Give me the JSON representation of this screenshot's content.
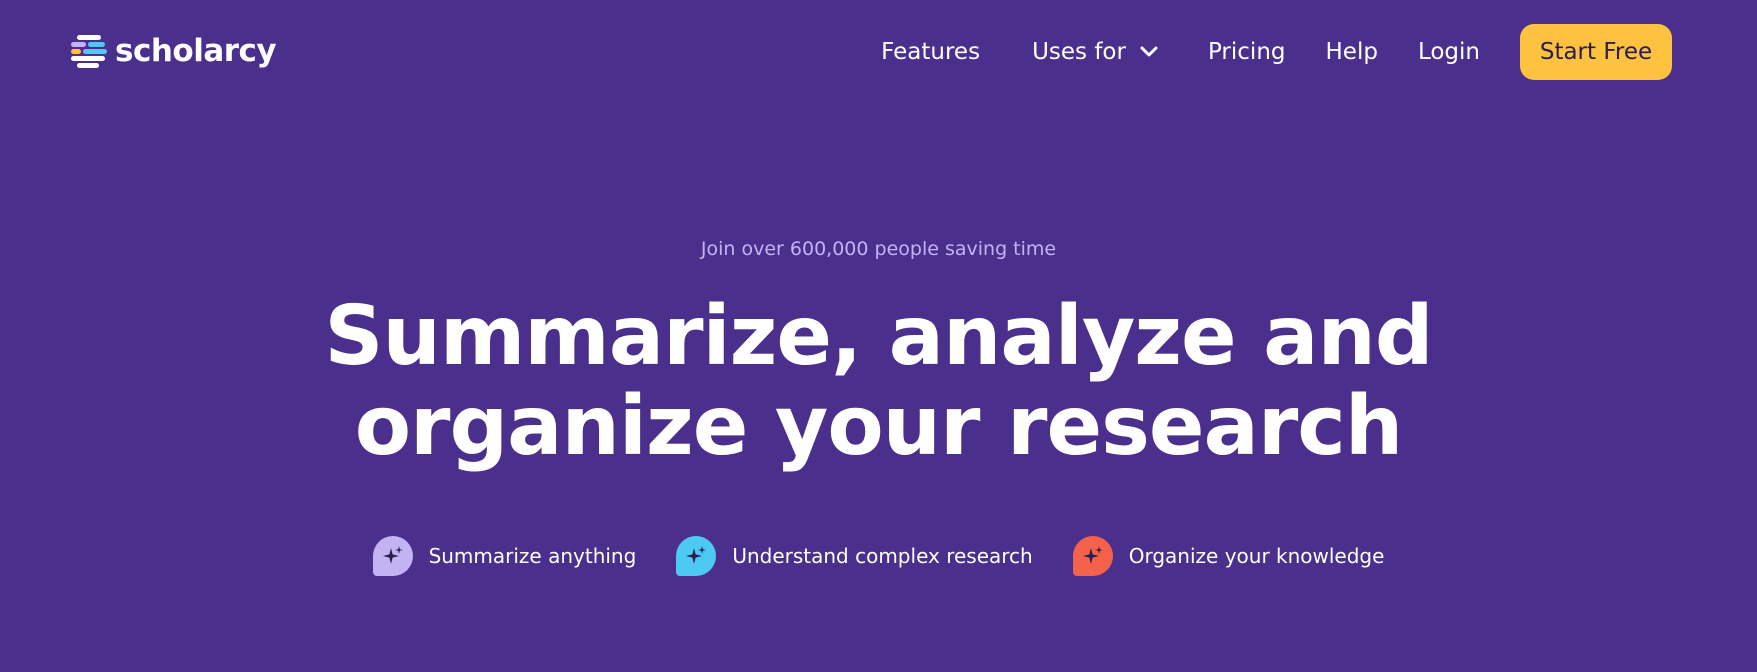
{
  "header": {
    "logo_text": "scholarcy",
    "nav": {
      "features": "Features",
      "uses_for": "Uses for",
      "pricing": "Pricing",
      "help": "Help",
      "login": "Login"
    },
    "cta_label": "Start Free"
  },
  "hero": {
    "tagline": "Join over 600,000 people saving time",
    "headline_line1": "Summarize, analyze and",
    "headline_line2": "organize your research",
    "features": [
      {
        "label": "Summarize anything",
        "icon": "sparkle-icon",
        "color": "#c4b3f2"
      },
      {
        "label": "Understand complex research",
        "icon": "sparkle-icon",
        "color": "#4cc9f5"
      },
      {
        "label": "Organize your knowledge",
        "icon": "sparkle-icon",
        "color": "#f5624b"
      }
    ]
  },
  "colors": {
    "background": "#4b2f8c",
    "cta": "#fdc23f",
    "tagline": "#c4b3f2",
    "logo_bars": [
      "#c4b3f2",
      "#4cc9f5",
      "#fdc23f",
      "#ffffff"
    ]
  }
}
